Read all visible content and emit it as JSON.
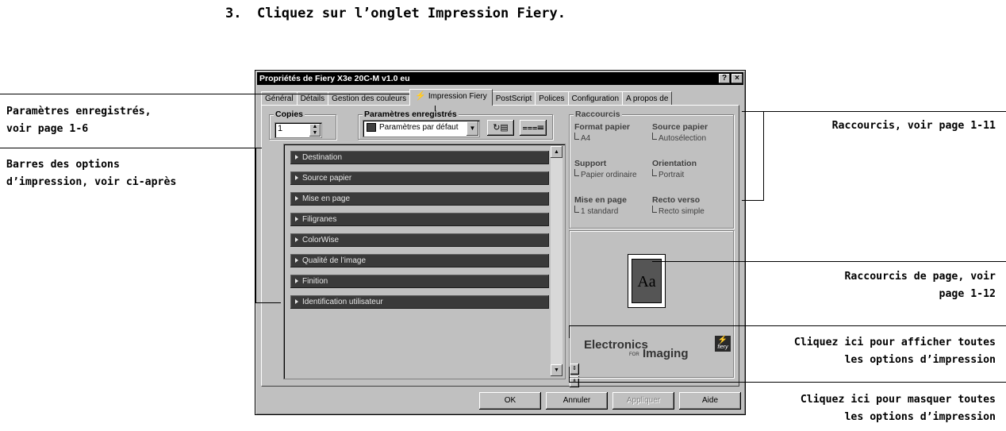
{
  "step": {
    "number": "3.",
    "text": "Cliquez sur l’onglet Impression Fiery."
  },
  "callouts": {
    "saved_settings": [
      "Paramètres enregistrés,",
      "voir page 1-6"
    ],
    "option_bars": [
      "Barres des options",
      "d’impression, voir ci-après"
    ],
    "shortcuts": [
      "Raccourcis, voir page 1-11"
    ],
    "page_shortcuts": [
      "Raccourcis de page, voir",
      "page 1-12"
    ],
    "show_all": [
      "Cliquez ici pour afficher toutes",
      "les options d’impression"
    ],
    "hide_all": [
      "Cliquez ici pour masquer toutes",
      "les options d’impression"
    ]
  },
  "window": {
    "title": "Propriétés de Fiery X3e 20C-M v1.0 eu",
    "help_button": "?",
    "close_button": "×",
    "tabs": [
      {
        "label": "Général",
        "active": false
      },
      {
        "label": "Détails",
        "active": false
      },
      {
        "label": "Gestion des couleurs",
        "active": false
      },
      {
        "label": "Impression Fiery",
        "active": true
      },
      {
        "label": "PostScript",
        "active": false
      },
      {
        "label": "Polices",
        "active": false
      },
      {
        "label": "Configuration",
        "active": false
      },
      {
        "label": "A propos de",
        "active": false
      }
    ],
    "active_tab_icon": "fiery-bolt-icon",
    "copies": {
      "label": "Copies",
      "value": "1"
    },
    "saved_settings": {
      "label": "Paramètres enregistrés",
      "selected": "Paramètres par défaut"
    },
    "option_bars": [
      "Destination",
      "Source papier",
      "Mise en page",
      "Filigranes",
      "ColorWise",
      "Qualité de l’image",
      "Finition",
      "Identification utilisateur"
    ],
    "shortcuts": {
      "title": "Raccourcis",
      "items": [
        {
          "label": "Format papier",
          "value": "A4"
        },
        {
          "label": "Source papier",
          "value": "Autosélection"
        },
        {
          "label": "Support",
          "value": "Papier ordinaire"
        },
        {
          "label": "Orientation",
          "value": "Portrait"
        },
        {
          "label": "Mise en page",
          "value": "1 standard"
        },
        {
          "label": "Recto verso",
          "value": "Recto simple"
        }
      ]
    },
    "preview": {
      "page_text": "Aa"
    },
    "logo": {
      "line1": "Electronics",
      "small": "FOR",
      "line2": "Imaging",
      "badge": "fiery"
    },
    "footer": {
      "ok": "OK",
      "cancel": "Annuler",
      "apply": "Appliquer",
      "help": "Aide"
    }
  }
}
